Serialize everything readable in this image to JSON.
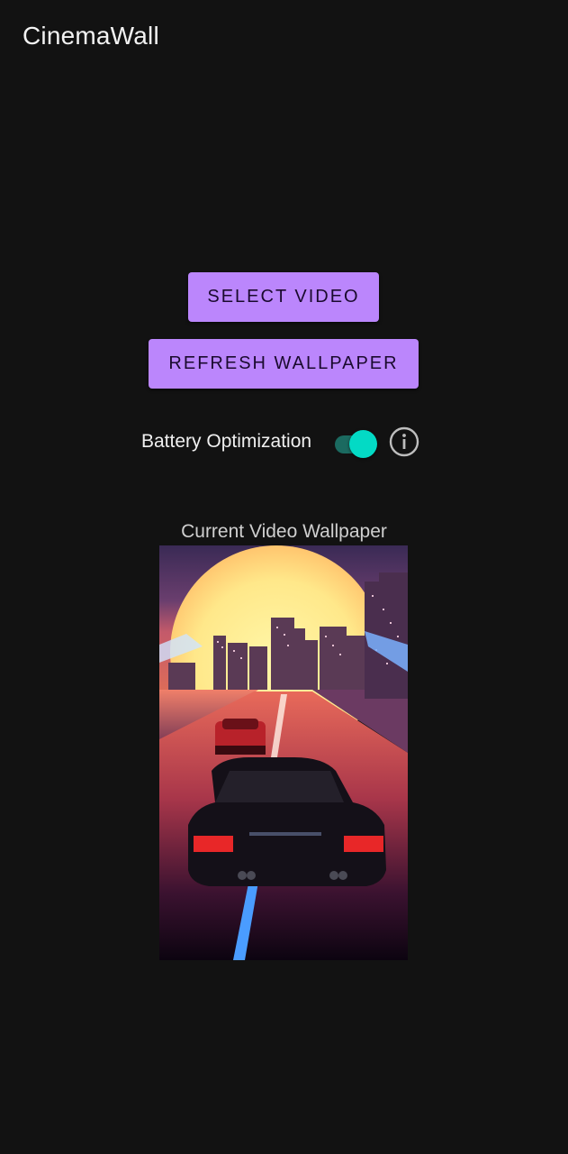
{
  "app": {
    "title": "CinemaWall"
  },
  "buttons": {
    "select_video": "SELECT VIDEO",
    "refresh_wallpaper": "REFRESH WALLPAPER"
  },
  "battery": {
    "label": "Battery Optimization",
    "enabled": true,
    "info_icon": "info-icon"
  },
  "preview": {
    "caption": "Current Video Wallpaper",
    "image_description_icon": "video-thumbnail"
  },
  "colors": {
    "background": "#121212",
    "button": "#bb86fc",
    "toggle_thumb": "#03dac5",
    "toggle_track": "#1b6a60"
  }
}
